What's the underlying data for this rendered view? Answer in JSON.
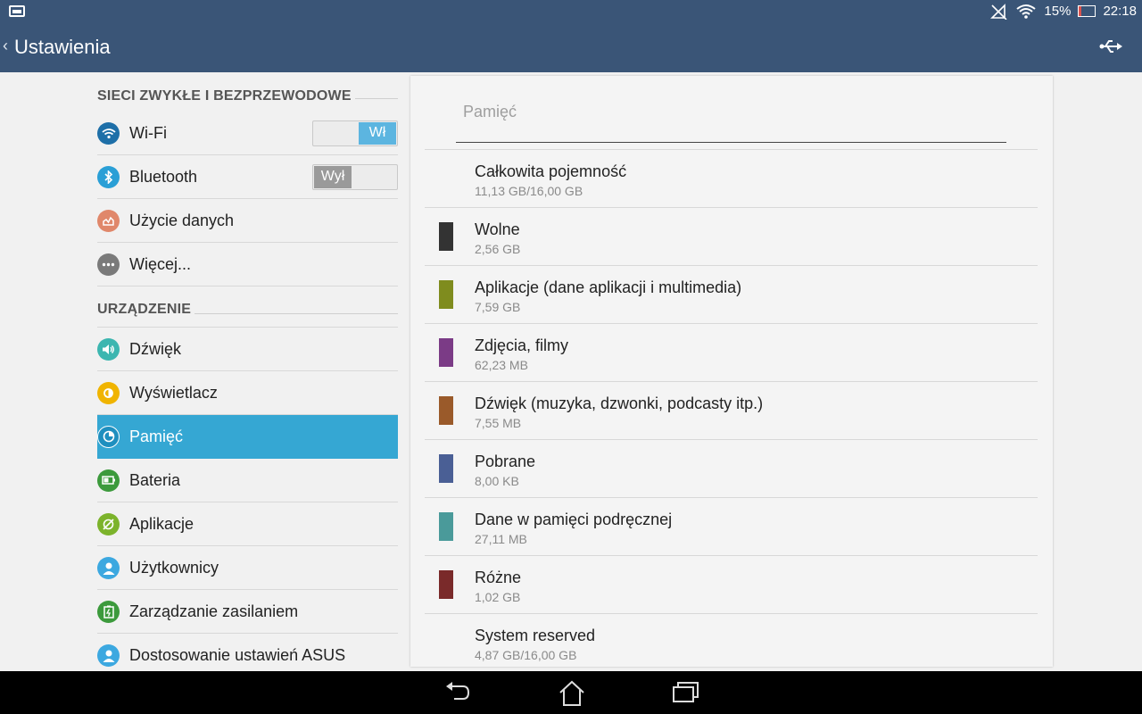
{
  "status_bar": {
    "battery_percent": "15%",
    "time": "22:18"
  },
  "app_bar": {
    "title": "Ustawienia"
  },
  "left_panel": {
    "sections": [
      {
        "header": "SIECI ZWYKŁE I BEZPRZEWODOWE",
        "items": [
          {
            "label": "Wi-Fi",
            "icon": "wifi-icon",
            "color": "#1e6fa8",
            "toggle": "Wł"
          },
          {
            "label": "Bluetooth",
            "icon": "bluetooth-icon",
            "color": "#2a9fd6",
            "toggle": "Wył"
          },
          {
            "label": "Użycie danych",
            "icon": "data-usage-icon",
            "color": "#e0876a"
          },
          {
            "label": "Więcej...",
            "icon": "more-icon",
            "color": "#7a7a7a"
          }
        ]
      },
      {
        "header": "URZĄDZENIE",
        "items": [
          {
            "label": "Dźwięk",
            "icon": "sound-icon",
            "color": "#3cb6b0"
          },
          {
            "label": "Wyświetlacz",
            "icon": "display-icon",
            "color": "#f0b400"
          },
          {
            "label": "Pamięć",
            "icon": "storage-icon",
            "color": "#1e8fbf",
            "selected": true
          },
          {
            "label": "Bateria",
            "icon": "battery-icon",
            "color": "#3c9a3c"
          },
          {
            "label": "Aplikacje",
            "icon": "apps-icon",
            "color": "#7cb32b"
          },
          {
            "label": "Użytkownicy",
            "icon": "users-icon",
            "color": "#3ca8e0"
          },
          {
            "label": "Zarządzanie zasilaniem",
            "icon": "power-management-icon",
            "color": "#3c9a3c"
          },
          {
            "label": "Dostosowanie ustawień ASUS",
            "icon": "asus-settings-icon",
            "color": "#3ca8e0"
          }
        ]
      }
    ]
  },
  "right_panel": {
    "title": "Pamięć",
    "rows": [
      {
        "name": "Całkowita pojemność",
        "value": "11,13 GB/16,00 GB",
        "color": null
      },
      {
        "name": "Wolne",
        "value": "2,56 GB",
        "color": "#333333"
      },
      {
        "name": "Aplikacje (dane aplikacji i multimedia)",
        "value": "7,59 GB",
        "color": "#7f8c1e"
      },
      {
        "name": "Zdjęcia, filmy",
        "value": "62,23 MB",
        "color": "#7b3b86"
      },
      {
        "name": "Dźwięk (muzyka, dzwonki, podcasty itp.)",
        "value": "7,55 MB",
        "color": "#9a5a2a"
      },
      {
        "name": "Pobrane",
        "value": "8,00 KB",
        "color": "#4a5f95"
      },
      {
        "name": "Dane w pamięci podręcznej",
        "value": "27,11 MB",
        "color": "#4a9a9a"
      },
      {
        "name": "Różne",
        "value": "1,02 GB",
        "color": "#7a2a2a"
      },
      {
        "name": "System reserved",
        "value": "4,87 GB/16,00 GB",
        "color": null
      }
    ]
  },
  "nav_bar": {
    "buttons": [
      "back-icon",
      "home-icon",
      "recents-icon"
    ]
  }
}
